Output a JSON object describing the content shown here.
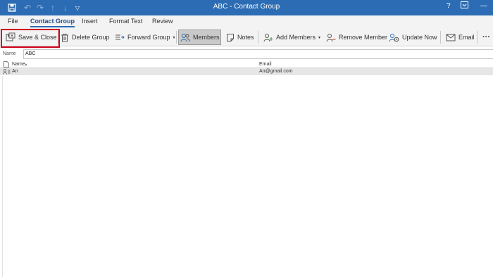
{
  "window": {
    "title": "ABC  -  Contact Group",
    "help_label": "?",
    "minimize_label": "—"
  },
  "menu": {
    "tabs": [
      "File",
      "Contact Group",
      "Insert",
      "Format Text",
      "Review"
    ],
    "active_tab": "Contact Group"
  },
  "ribbon": {
    "save_close": "Save & Close",
    "delete_group": "Delete Group",
    "forward_group": "Forward Group",
    "members": "Members",
    "notes": "Notes",
    "add_members": "Add Members",
    "remove_member": "Remove Member",
    "update_now": "Update Now",
    "email": "Email",
    "more": "···"
  },
  "form": {
    "name_label": "Name",
    "name_value": "ABC"
  },
  "members_table": {
    "headers": {
      "name": "Name",
      "email": "Email"
    },
    "rows": [
      {
        "name": "An",
        "email": "An@gmail.com"
      }
    ]
  },
  "colors": {
    "title_bar": "#2b6cb4",
    "highlight_box": "#d0021b"
  }
}
